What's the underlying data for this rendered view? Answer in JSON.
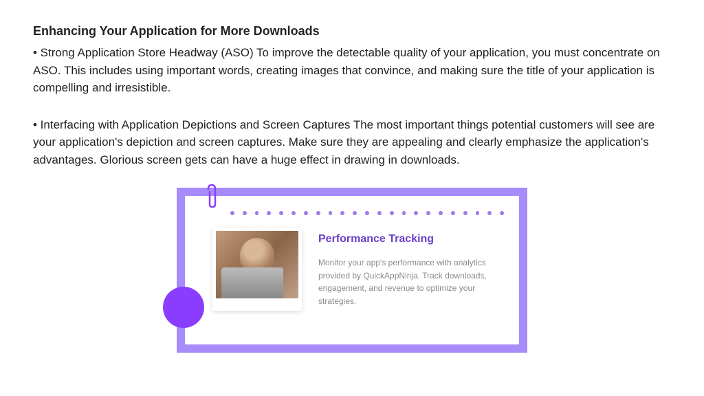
{
  "heading": "Enhancing Your Application for More Downloads",
  "paragraphs": [
    "• Strong Application Store Headway (ASO) To improve the detectable quality of your application, you must concentrate on ASO. This includes using important words, creating images that convince, and making sure the title of your application is compelling and irresistible.",
    "• Interfacing with Application Depictions and Screen Captures The most important things potential customers will see are your application's depiction and screen captures. Make sure they are appealing and clearly emphasize the application's advantages. Glorious screen gets can have a huge effect in drawing in downloads."
  ],
  "card": {
    "title": "Performance Tracking",
    "description": "Monitor your app's performance with analytics provided by QuickAppNinja. Track downloads, engagement, and revenue to optimize your strategies.",
    "dotCount": 23
  }
}
